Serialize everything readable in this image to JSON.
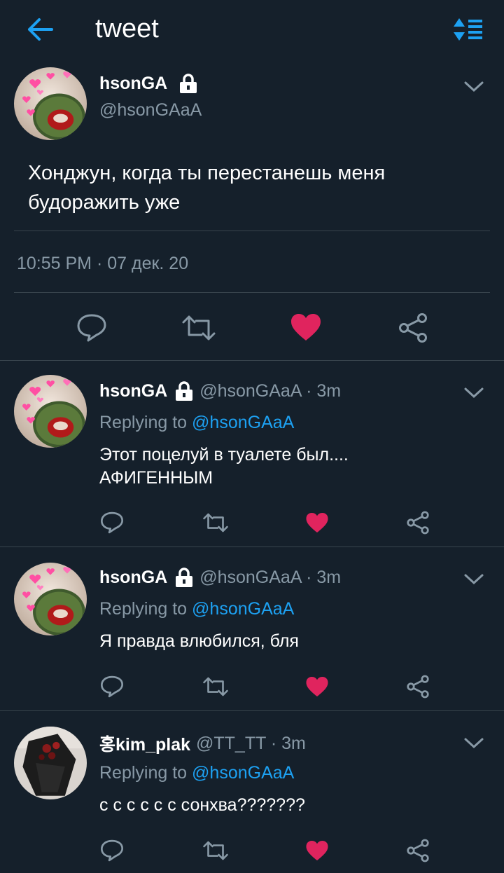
{
  "header": {
    "title": "tweet",
    "back_icon": "arrow-left-icon",
    "sort_icon": "sort-icon"
  },
  "colors": {
    "background": "#15202b",
    "accent": "#1da1f2",
    "like": "#e0245e",
    "muted": "#8899a6"
  },
  "main_tweet": {
    "name": "hsonGA",
    "handle": "@hsonGAaA",
    "text": "Хонджун, когда ты перестанешь меня будоражить уже",
    "timestamp": "10:55 PM · 07 дек. 20",
    "liked": true
  },
  "replies": [
    {
      "name": "hsonGA",
      "handle": "@hsonGAaA · 3m",
      "replying_prefix": "Replying to ",
      "replying_to": "@hsonGAaA",
      "line1": "Этот поцелуй в туалете был....",
      "line2": "АФИГЕННЫМ",
      "liked": true
    },
    {
      "name": "hsonGA",
      "handle": "@hsonGAaA · 3m",
      "replying_prefix": "Replying to ",
      "replying_to": "@hsonGAaA",
      "line1": "Я правда влюбился, бля",
      "liked": true
    },
    {
      "name": "홍kim_plak",
      "handle": "@TT_TT · 3m",
      "replying_prefix": "Replying to ",
      "replying_to": "@hsonGAaA",
      "line1": "с с с с с с сонхва???????",
      "liked": true
    }
  ]
}
